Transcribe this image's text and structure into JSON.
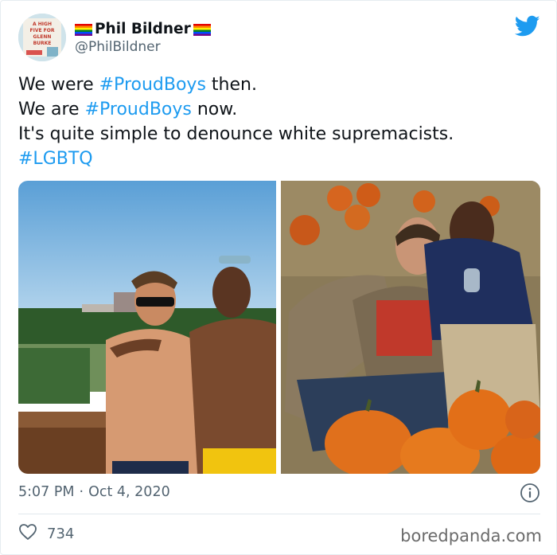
{
  "author": {
    "name": "Phil Bildner",
    "handle": "@PhilBildner",
    "avatar_cover_text": "A HIGH FIVE FOR GLENN BURKE"
  },
  "tweet": {
    "line1_prefix": "We were ",
    "line1_hashtag": "#ProudBoys",
    "line1_suffix": " then.",
    "line2_prefix": "We are ",
    "line2_hashtag": "#ProudBoys",
    "line2_suffix": " now.",
    "line3": "It's quite simple to denounce white supremacists.",
    "line4_hashtag": "#LGBTQ"
  },
  "media": {
    "left_photo": "two-men-shirtless-at-beach-then",
    "right_photo": "two-men-at-pumpkin-patch-now"
  },
  "meta": {
    "time": "5:07 PM",
    "separator": "·",
    "date": "Oct 4, 2020"
  },
  "engagement": {
    "like_count": "734"
  },
  "watermark": "boredpanda.com",
  "colors": {
    "hashtag": "#1d9bf0",
    "twitter_blue": "#1d9bf0",
    "secondary_text": "#536471"
  },
  "icons": [
    "twitter-bird-icon",
    "rainbow-flag-icon",
    "info-icon",
    "heart-icon"
  ]
}
